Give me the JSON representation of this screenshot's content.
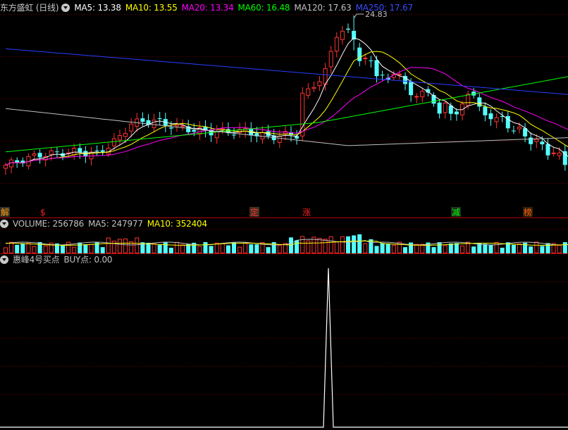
{
  "chart_data": [
    {
      "type": "candlestick",
      "title": "东方盛虹 (日线)",
      "indicators": [
        {
          "name": "MA5",
          "label": "MA5: 13.38",
          "color": "#ffffff"
        },
        {
          "name": "MA10",
          "label": "MA10: 13.55",
          "color": "#ffff00"
        },
        {
          "name": "MA20",
          "label": "MA20: 13.34",
          "color": "#ff00ff"
        },
        {
          "name": "MA60",
          "label": "MA60: 16.48",
          "color": "#00ff00"
        },
        {
          "name": "MA120",
          "label": "MA120: 17.63",
          "color": "#c0c0c0"
        },
        {
          "name": "MA250",
          "label": "MA250: 17.67",
          "color": "#2a3cff"
        }
      ],
      "high_annotation": "24.83",
      "signals": [
        {
          "text": "解",
          "color": "#ff9c00",
          "bg": "#303030"
        },
        {
          "text": "$",
          "color": "#ff2020",
          "bg": "#000000"
        },
        {
          "text": "定",
          "color": "#ff3030",
          "bg": "#403020"
        },
        {
          "text": "涨",
          "color": "#ff2020",
          "bg": "#000000"
        },
        {
          "text": "减",
          "color": "#00ff00",
          "bg": "#203020"
        },
        {
          "text": "榜",
          "color": "#ff6000",
          "bg": "#302010"
        }
      ],
      "colors": {
        "up": "#ff3333",
        "down": "#54ffff"
      }
    },
    {
      "type": "bar",
      "title": "VOLUME",
      "indicators": [
        {
          "name": "VOLUME",
          "label": "VOLUME: 256786",
          "color": "#c0c0c0"
        },
        {
          "name": "MA5",
          "label": "MA5: 247977",
          "color": "#c0c0c0"
        },
        {
          "name": "MA10",
          "label": "MA10: 352404",
          "color": "#ffff00"
        }
      ]
    },
    {
      "type": "line",
      "title": "惠峰4号买点",
      "indicators": [
        {
          "name": "BUY点",
          "label": "BUY点: 0.00",
          "color": "#c0c0c0"
        }
      ]
    }
  ]
}
